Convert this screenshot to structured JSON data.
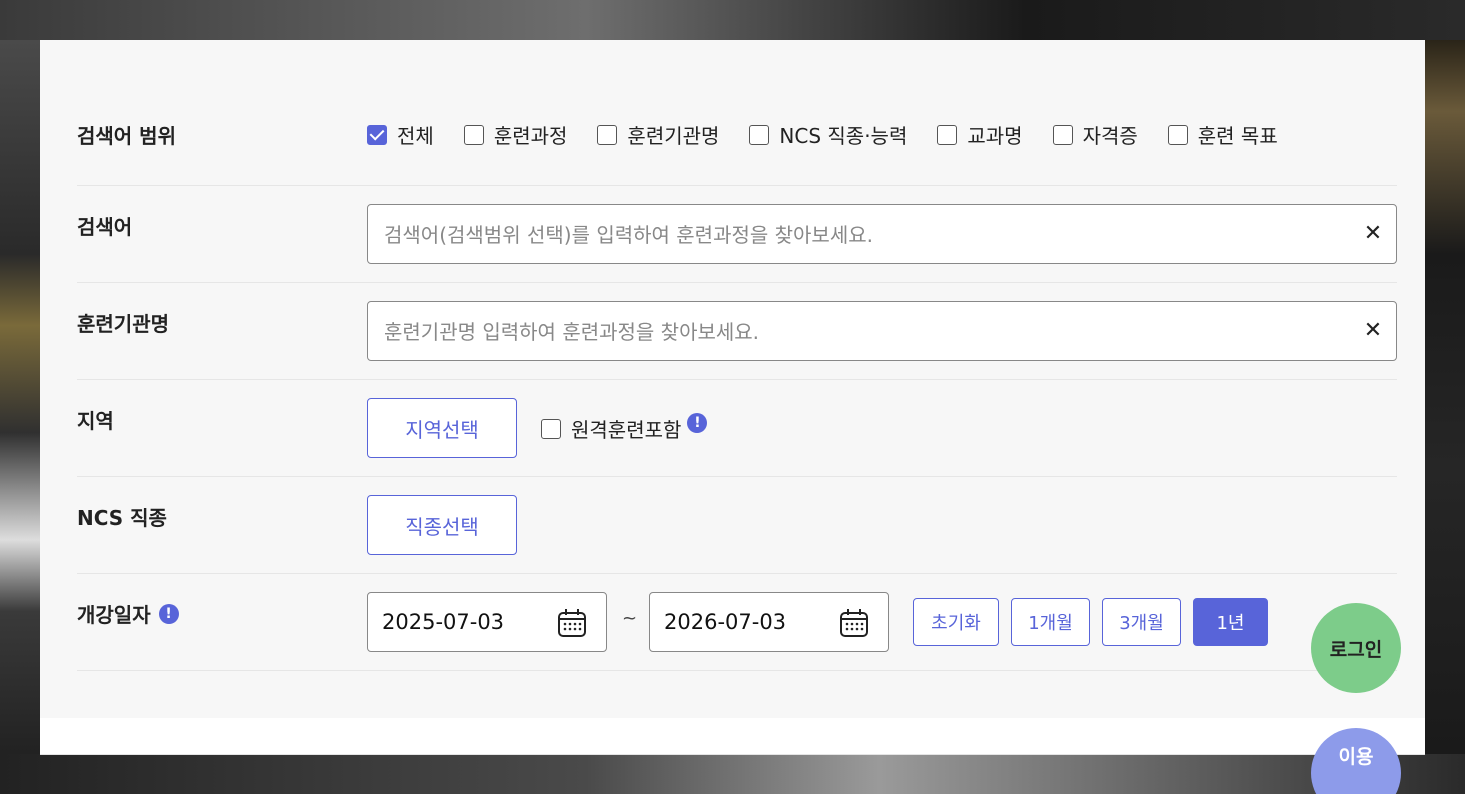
{
  "search_scope": {
    "label": "검색어 범위",
    "options": [
      {
        "label": "전체",
        "checked": true
      },
      {
        "label": "훈련과정",
        "checked": false
      },
      {
        "label": "훈련기관명",
        "checked": false
      },
      {
        "label": "NCS 직종·능력",
        "checked": false
      },
      {
        "label": "교과명",
        "checked": false
      },
      {
        "label": "자격증",
        "checked": false
      },
      {
        "label": "훈련 목표",
        "checked": false
      }
    ]
  },
  "keyword": {
    "label": "검색어",
    "placeholder": "검색어(검색범위 선택)를 입력하여 훈련과정을 찾아보세요.",
    "value": ""
  },
  "institution": {
    "label": "훈련기관명",
    "placeholder": "훈련기관명 입력하여 훈련과정을 찾아보세요.",
    "value": ""
  },
  "region": {
    "label": "지역",
    "select_button": "지역선택",
    "remote_checkbox": {
      "label": "원격훈련포함",
      "checked": false
    },
    "info_icon": "info-icon"
  },
  "ncs": {
    "label": "NCS 직종",
    "select_button": "직종선택"
  },
  "start_date": {
    "label": "개강일자",
    "from": "2025-07-03",
    "separator": "~",
    "to": "2026-07-03",
    "buttons": [
      {
        "label": "초기화",
        "active": false
      },
      {
        "label": "1개월",
        "active": false
      },
      {
        "label": "3개월",
        "active": false
      },
      {
        "label": "1년",
        "active": true
      }
    ]
  },
  "floating": {
    "login": "로그인",
    "second_partial": "이용"
  },
  "colors": {
    "accent": "#5864d9",
    "login_bg": "#7dcc8a",
    "second_bg": "#8d9bea"
  }
}
